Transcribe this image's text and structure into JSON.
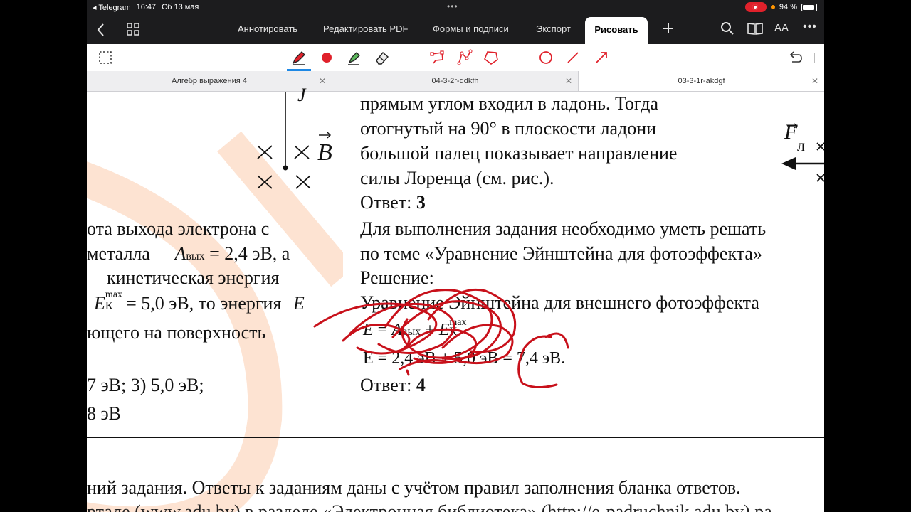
{
  "status_bar": {
    "app": "◂ Telegram",
    "time": "16:47",
    "date": "Сб 13 мая",
    "battery": "94 %"
  },
  "toolbar": {
    "items": [
      "Аннотировать",
      "Редактировать PDF",
      "Формы и подписи",
      "Экспорт"
    ],
    "active": "Рисовать",
    "text_size_label": "AA"
  },
  "draw_tools": [
    "pen-tool",
    "color-red",
    "highlighter-tool",
    "eraser-tool",
    "lasso-tool",
    "polyline-tool",
    "polygon-tool",
    "circle-tool",
    "line-tool",
    "arrow-tool",
    "undo"
  ],
  "accent_color": "#e0212b",
  "tabs": [
    {
      "label": "Алгебр выражения 4",
      "active": false
    },
    {
      "label": "04-3-2r-ddkfh",
      "active": false
    },
    {
      "label": "03-3-1r-akdgf",
      "active": true
    }
  ],
  "doc": {
    "cell1_right_lines": [
      "прямым   углом   входил   в   ладонь.  Тогда",
      "отогнутый   на   90°   в   плоскости   ладони",
      "большой   палец   показывает   направление",
      "силы Лоренца (см. рис.)."
    ],
    "answer_label": "Ответ:",
    "answer1": "3",
    "fig_b": "B",
    "fig_f": "F",
    "fig_f_sub": "Л",
    "fig_j": "J",
    "cell2_left": {
      "l1": "ота   выхода   электрона   с",
      "l2a": "металла",
      "l2_a": "A",
      "l2_a_sub": "вых",
      "l2b": "= 2,4   эВ,   а",
      "l3": "кинетическая          энергия",
      "l4_e": "E",
      "l4_e_sub": "К",
      "l4_e_sup": "max",
      "l4b": "= 5,0 эВ,   то   энергия",
      "l4_e2": "E",
      "l5": "ющего       на       поверхность",
      "l6": "7 эВ;    3) 5,0 эВ;",
      "l7": "8 эВ"
    },
    "cell2_right": {
      "l1": "Для выполнения задания необходимо уметь решать",
      "l2": "по теме «Уравнение Эйнштейна для фотоэффекта»",
      "l3": "Решение:",
      "l4": "Уравнение Эйнштейна для внешнего фотоэффекта",
      "f1_e": "E",
      "f1_eq": "=",
      "f1_a": "A",
      "f1_a_sub": "вых",
      "f1_plus": "+",
      "f1_e2": "E",
      "f1_e2_sub": "К",
      "f1_e2_sup": "max",
      "f2": "E = 2,4 эВ + 5,0 эВ = 7,4 эВ.",
      "answer2": "4"
    },
    "footer1": "ний задания. Ответы к заданиям даны с учётом правил заполнения бланка ответов.",
    "footer2": "ртале (www.adu.by) в разделе «Электронная библиотека» (http://e-padruchnik.adu.by) ра"
  }
}
